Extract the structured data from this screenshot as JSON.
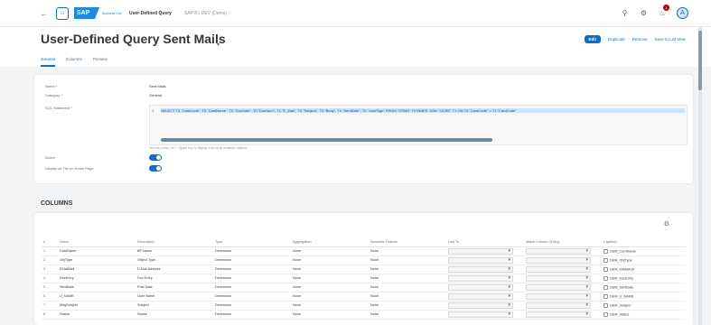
{
  "shell": {
    "back_icon": "arrow-left-icon",
    "home_icon": "home-icon",
    "logo_text": "SAP",
    "logo_sub": "Business One",
    "title": "User-Defined Query",
    "system": "SAP B1 DEV (Demo)",
    "notification_count": "1",
    "avatar_letter": "A"
  },
  "header": {
    "title": "User-Defined Query Sent Mails",
    "actions": {
      "edit": "Edit",
      "duplicate": "Duplicate",
      "remove": "Remove",
      "save_as_list": "Save to List View"
    },
    "tabs": [
      "General",
      "Columns",
      "Preview"
    ]
  },
  "general": {
    "fields": [
      {
        "label": "Name *",
        "value": "Sent Mails"
      },
      {
        "label": "Category *",
        "value": "General"
      },
      {
        "label": "SQL Statement *",
        "value": ""
      }
    ],
    "sql_line_number": "1",
    "sql_text": "SELECT T0.\"CardCode\", T0.\"CardName\", T0.\"DocDate\", T0.\"DocNum\", T1.\"E_Mail\", T0.\"Subject\", T0.\"Body\", T0.\"SentDate\", T0.\"UserSign\" FROM \"OSMS\" T0 INNER JOIN \"OCRD\" T1 ON T0.\"CardCode\" = T1.\"CardCode\"",
    "hint": "You can press Ctrl + Space key to display a list of all available objects.",
    "active_label": "Active",
    "display_tile_label": "Display as Tile on Home Page"
  },
  "columns": {
    "title": "COLUMNS",
    "headers": [
      "#",
      "Name",
      "Description",
      "Type",
      "Aggregation",
      "Semantic Feature",
      "Link To",
      "Match Column (If Any)",
      "Captions"
    ],
    "rows": [
      {
        "n": "1",
        "name": "CardName",
        "desc": "BP Name",
        "type": "Dimension",
        "agg": "None",
        "sem": "None",
        "caption": "DEM_CardName"
      },
      {
        "n": "2",
        "name": "ObjType",
        "desc": "Object Type",
        "type": "Dimension",
        "agg": "None",
        "sem": "None",
        "caption": "DEM_ObjType"
      },
      {
        "n": "3",
        "name": "EMailAdd",
        "desc": "E-Mail Address",
        "type": "Dimension",
        "agg": "None",
        "sem": "None",
        "caption": "DEM_EMailAdd"
      },
      {
        "n": "4",
        "name": "DocEntry",
        "desc": "Doc Entry",
        "type": "Dimension",
        "agg": "None",
        "sem": "None",
        "caption": "DEM_DocEntry"
      },
      {
        "n": "5",
        "name": "SentDate",
        "desc": "Post Date",
        "type": "Dimension",
        "agg": "None",
        "sem": "None",
        "caption": "DEM_SentDate"
      },
      {
        "n": "6",
        "name": "U_NAME",
        "desc": "User Name",
        "type": "Dimension",
        "agg": "None",
        "sem": "None",
        "caption": "DEM_U_NAME"
      },
      {
        "n": "7",
        "name": "MsgSubject",
        "desc": "Subject",
        "type": "Dimension",
        "agg": "None",
        "sem": "None",
        "caption": "DEM_Subject"
      },
      {
        "n": "8",
        "name": "Status",
        "desc": "Status",
        "type": "Dimension",
        "agg": "None",
        "sem": "None",
        "caption": "DEM_Status"
      }
    ]
  },
  "colors": {
    "accent": "#0a6ed1",
    "shell_bg": "#ffffff",
    "page_bg": "#f2f4f6",
    "notification": "#bb0000"
  }
}
